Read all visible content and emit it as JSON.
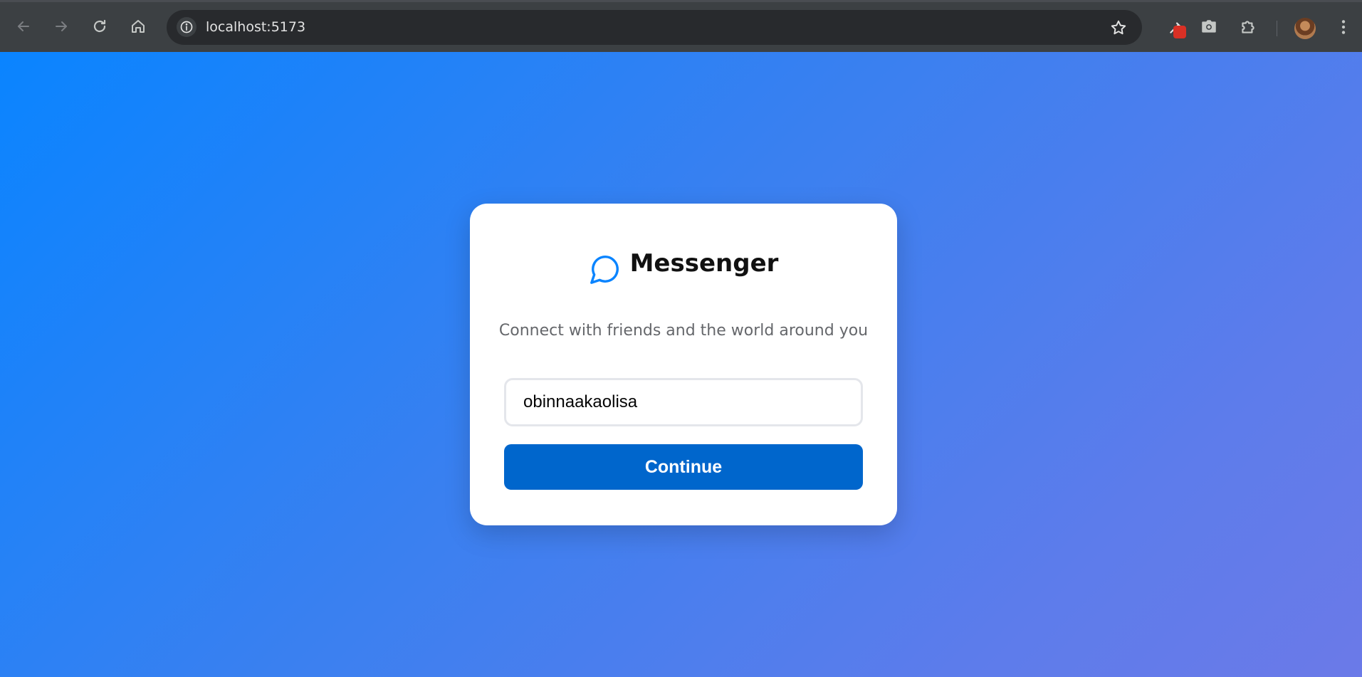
{
  "browser": {
    "url": "localhost:5173",
    "icons": {
      "back": "arrow-left-icon",
      "forward": "arrow-right-icon",
      "reload": "reload-icon",
      "home": "home-icon",
      "site_info": "info-icon",
      "bookmark": "star-icon",
      "extension_eyedropper": "eyedropper-icon",
      "extension_screenshot": "camera-icon",
      "extensions": "puzzle-icon",
      "menu": "kebab-menu-icon"
    }
  },
  "login": {
    "app_name": "Messenger",
    "tagline": "Connect with friends and the world around you",
    "username_value": "obinnaakaolisa",
    "continue_label": "Continue"
  },
  "colors": {
    "accent": "#0a84ff",
    "button": "#0066cc",
    "background_start": "#0a84ff",
    "background_end": "#6b7ae8"
  }
}
